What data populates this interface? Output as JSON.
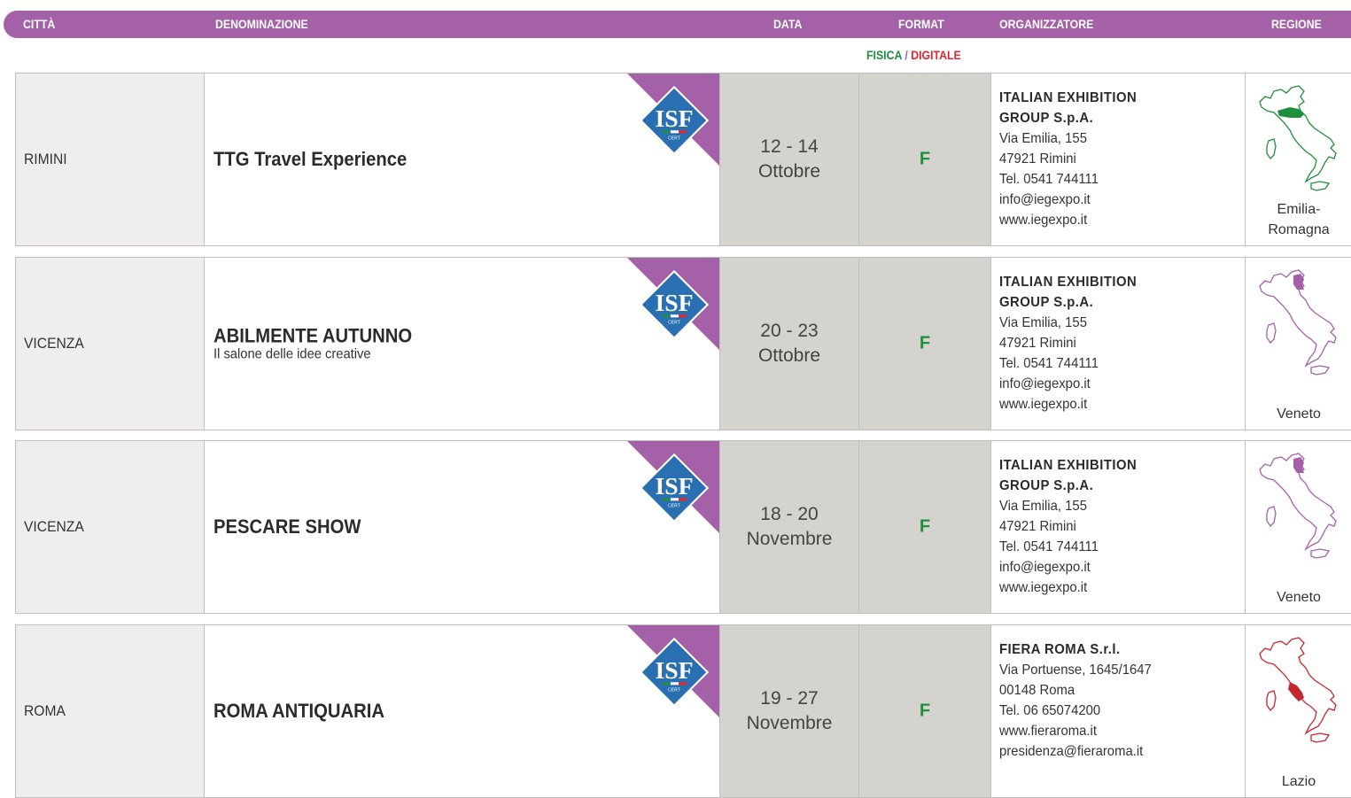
{
  "header": {
    "citta": "CITTÀ",
    "denominazione": "DENOMINAZIONE",
    "data": "DATA",
    "format": "FORMAT",
    "organizzatore": "ORGANIZZATORE",
    "regione": "REGIONE"
  },
  "legend": {
    "fisica": "FISICA",
    "sep": " / ",
    "digitale": "DIGITALE"
  },
  "colors": {
    "accent": "#a561a8",
    "fisica": "#1e8f3c",
    "digitale": "#e3262f",
    "date_bg": "#d4d3ce",
    "city_bg": "#efeeec"
  },
  "rows": [
    {
      "city": "RIMINI",
      "name": "TTG Travel Experience",
      "subtitle": "",
      "badge": "ISF CERT",
      "date_range": "12 - 14",
      "date_month": "Ottobre",
      "format": "F",
      "org_name_1": "ITALIAN EXHIBITION",
      "org_name_2": "GROUP S.p.A.",
      "org_lines": [
        "Via Emilia, 155",
        "47921 Rimini",
        "Tel. 0541 744111",
        "info@iegexpo.it",
        "www.iegexpo.it"
      ],
      "region": "Emilia-\nRomagna",
      "map_color": "#1e8f3c",
      "map_icon": "italy-map-icon"
    },
    {
      "city": "VICENZA",
      "name": "ABILMENTE AUTUNNO",
      "subtitle": "Il salone delle idee creative",
      "badge": "ISF CERT",
      "date_range": "20 - 23",
      "date_month": "Ottobre",
      "format": "F",
      "org_name_1": "ITALIAN EXHIBITION",
      "org_name_2": "GROUP S.p.A.",
      "org_lines": [
        "Via Emilia, 155",
        "47921 Rimini",
        "Tel. 0541 744111",
        "info@iegexpo.it",
        "www.iegexpo.it"
      ],
      "region": "Veneto",
      "map_color": "#a561a8",
      "map_icon": "italy-map-icon"
    },
    {
      "city": "VICENZA",
      "name": "PESCARE SHOW",
      "subtitle": "",
      "badge": "ISF CERT",
      "date_range": "18 - 20",
      "date_month": "Novembre",
      "format": "F",
      "org_name_1": "ITALIAN EXHIBITION",
      "org_name_2": "GROUP S.p.A.",
      "org_lines": [
        "Via Emilia, 155",
        "47921 Rimini",
        "Tel. 0541 744111",
        "info@iegexpo.it",
        "www.iegexpo.it"
      ],
      "region": "Veneto",
      "map_color": "#a561a8",
      "map_icon": "italy-map-icon"
    },
    {
      "city": "ROMA",
      "name": "ROMA ANTIQUARIA",
      "subtitle": "",
      "badge": "ISF CERT",
      "date_range": "19 - 27",
      "date_month": "Novembre",
      "format": "F",
      "org_name_1": "FIERA ROMA S.r.l.",
      "org_name_2": "",
      "org_lines": [
        "Via Portuense, 1645/1647",
        "00148 Roma",
        "Tel. 06 65074200",
        "www.fieraroma.it",
        "presidenza@fieraroma.it"
      ],
      "region": "Lazio",
      "map_color": "#c5272f",
      "map_icon": "italy-map-icon"
    }
  ]
}
